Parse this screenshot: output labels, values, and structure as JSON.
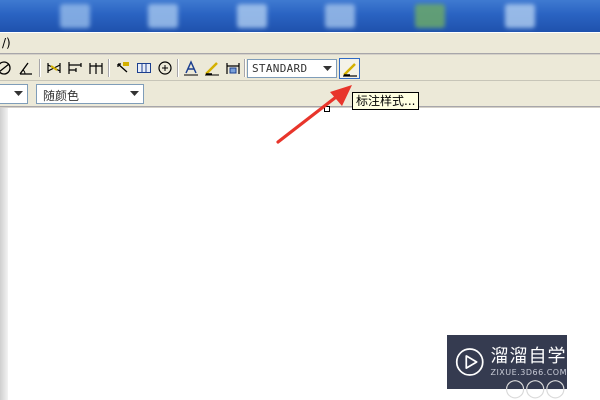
{
  "menubar": {
    "partial_text": "/)"
  },
  "toolbar": {
    "buttons": [
      {
        "name": "dim-diameter-icon",
        "glyph": "◎"
      },
      {
        "name": "dim-angular-icon",
        "glyph": "∆"
      },
      {
        "name": "quick-dimension-icon",
        "glyph": "⊓"
      },
      {
        "name": "baseline-dimension-icon",
        "glyph": "⊏"
      },
      {
        "name": "continue-dimension-icon",
        "glyph": "⊓"
      },
      {
        "name": "quick-leader-icon",
        "glyph": "↖"
      },
      {
        "name": "tolerance-icon",
        "glyph": "⊞"
      },
      {
        "name": "center-mark-icon",
        "glyph": "⊕"
      },
      {
        "name": "dim-edit-icon",
        "glyph": "A"
      },
      {
        "name": "dim-text-edit-icon",
        "glyph": "⁄"
      },
      {
        "name": "dim-update-icon",
        "glyph": "⊓"
      }
    ],
    "style_combo_value": "STANDARD"
  },
  "tooltip": {
    "text": "标注样式..."
  },
  "proprow": {
    "color_combo_value": "随颜色"
  },
  "watermark": {
    "title": "溜溜自学",
    "subtitle": "ZIXUE.3D66.COM"
  },
  "colors": {
    "taskbar": "#2a63c2",
    "tooltip_bg": "#ffffe1",
    "arrow": "#e8352b"
  }
}
